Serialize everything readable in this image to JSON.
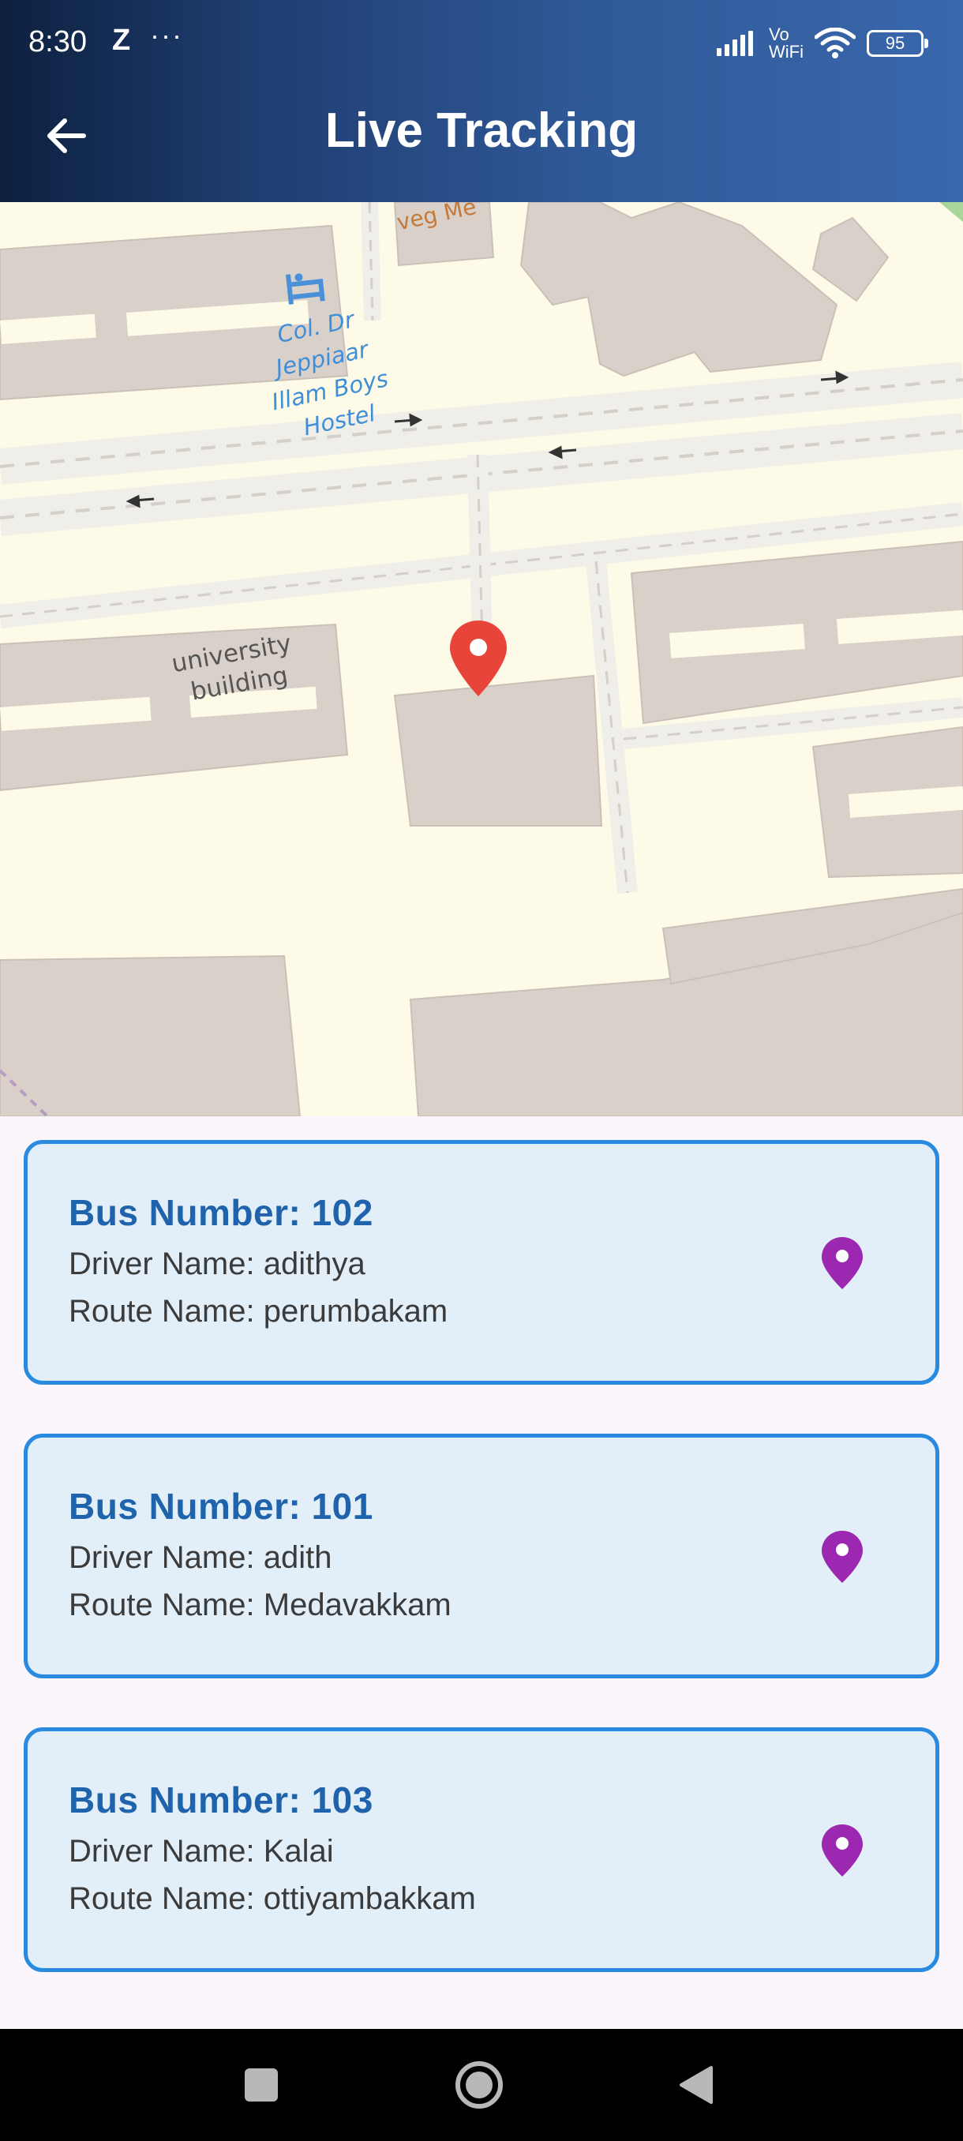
{
  "status_bar": {
    "time": "8:30",
    "app_indicator": "Z",
    "more_indicator": "···",
    "network_label_top": "Vo",
    "network_label_bottom": "WiFi",
    "battery_level": "95"
  },
  "header": {
    "title": "Live Tracking",
    "back_icon": "arrow-left-icon"
  },
  "map": {
    "labels": {
      "hostel_line1": "Col. Dr",
      "hostel_line2": "Jeppiaar",
      "hostel_line3": "Illam Boys",
      "hostel_line4": "Hostel",
      "building_line1": "university",
      "building_line2": "building",
      "top_partial": "veg Me"
    },
    "marker_icon": "map-marker-icon",
    "colors": {
      "land": "#fdfbe7",
      "building": "#d9d0c9",
      "road": "#f0eee8",
      "marker": "#e8443a"
    }
  },
  "buses": [
    {
      "number_label": "Bus Number: 102",
      "driver_label": "Driver Name: adithya",
      "route_label": "Route Name: perumbakam"
    },
    {
      "number_label": "Bus Number: 101",
      "driver_label": "Driver Name: adith",
      "route_label": "Route Name: Medavakkam"
    },
    {
      "number_label": "Bus Number: 103",
      "driver_label": "Driver Name: Kalai",
      "route_label": "Route Name: ottiyambakkam"
    }
  ],
  "colors": {
    "card_background": "#e2eff9",
    "card_border": "#2a8ae0",
    "bus_number_text": "#1f63ad",
    "pin": "#9c27b0",
    "header_gradient_start": "#0d203f",
    "header_gradient_end": "#3a68ad"
  },
  "nav": {
    "recents_icon": "square-icon",
    "home_icon": "circle-home-icon",
    "back_icon": "triangle-back-icon"
  }
}
